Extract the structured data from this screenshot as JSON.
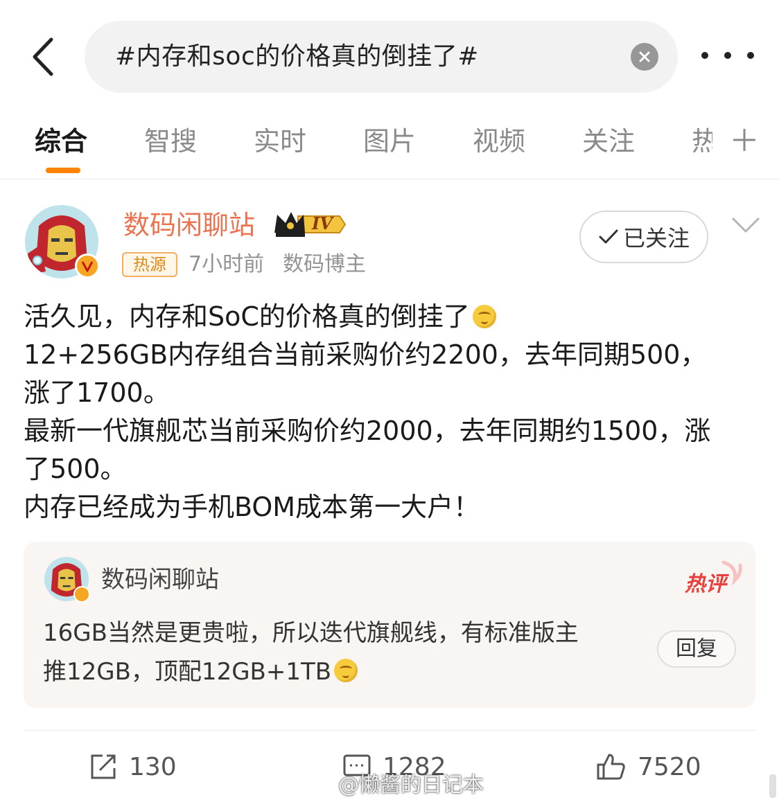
{
  "search": {
    "query": "#内存和soc的价格真的倒挂了#"
  },
  "tabs": [
    {
      "label": "综合",
      "active": true
    },
    {
      "label": "智搜"
    },
    {
      "label": "实时"
    },
    {
      "label": "图片"
    },
    {
      "label": "视频"
    },
    {
      "label": "关注"
    },
    {
      "label": "热"
    }
  ],
  "post": {
    "author": "数码闲聊站",
    "level_badge": "IV",
    "hot_source_badge": "热源",
    "time": "7小时前",
    "role": "数码博主",
    "follow_label": "已关注",
    "lines": [
      "活久见，内存和SoC的价格真的倒挂了",
      "12+256GB内存组合当前采购价约2200，去年同期500，",
      "涨了1700。",
      "最新一代旗舰芯当前采购价约2000，去年同期约1500，涨",
      "了500。",
      "内存已经成为手机BOM成本第一大户！"
    ]
  },
  "hot_comment": {
    "author": "数码闲聊站",
    "badge": "热评",
    "lines": [
      "16GB当然是更贵啦，所以迭代旗舰线，有标准版主",
      "推12GB，顶配12GB+1TB"
    ],
    "reply_label": "回复"
  },
  "actions": {
    "reposts": "130",
    "comments": "1282",
    "likes": "7520"
  },
  "watermark": {
    "text": "@懒酱的日记本"
  },
  "colors": {
    "accent": "#ff8200",
    "author_name": "#eb7350",
    "hot_badge": "#e8413d"
  }
}
